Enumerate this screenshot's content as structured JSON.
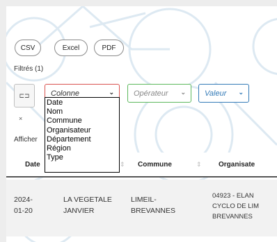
{
  "export_buttons": {
    "csv": "CSV",
    "excel": "Excel",
    "pdf": "PDF"
  },
  "filters": {
    "label": "Filtrés (1)",
    "side_button_glyph": "⊏⊐",
    "remove_glyph": "×",
    "column_select": {
      "value": "Colonne",
      "options": [
        "Date",
        "Nom",
        "Commune",
        "Organisateur",
        "Département",
        "Région",
        "Type"
      ]
    },
    "operator_select": {
      "value": "Opérateur"
    },
    "value_select": {
      "value": "Valeur"
    }
  },
  "afficher_label": "Afficher",
  "table": {
    "headers": [
      "Date",
      "Commune",
      "Organisate"
    ],
    "rows": [
      {
        "date": [
          "2024-",
          "01-20"
        ],
        "nom": [
          "LA VEGETALE",
          "JANVIER"
        ],
        "commune": [
          "LIMEIL-",
          "BREVANNES"
        ],
        "organisateur": [
          "04923 - ELAN",
          "CYCLO DE LIM",
          "BREVANNES"
        ]
      }
    ]
  },
  "colors": {
    "column_select_border": "#d9534f",
    "operator_select_border": "#5cb85c",
    "value_select_border": "#337ab7"
  }
}
